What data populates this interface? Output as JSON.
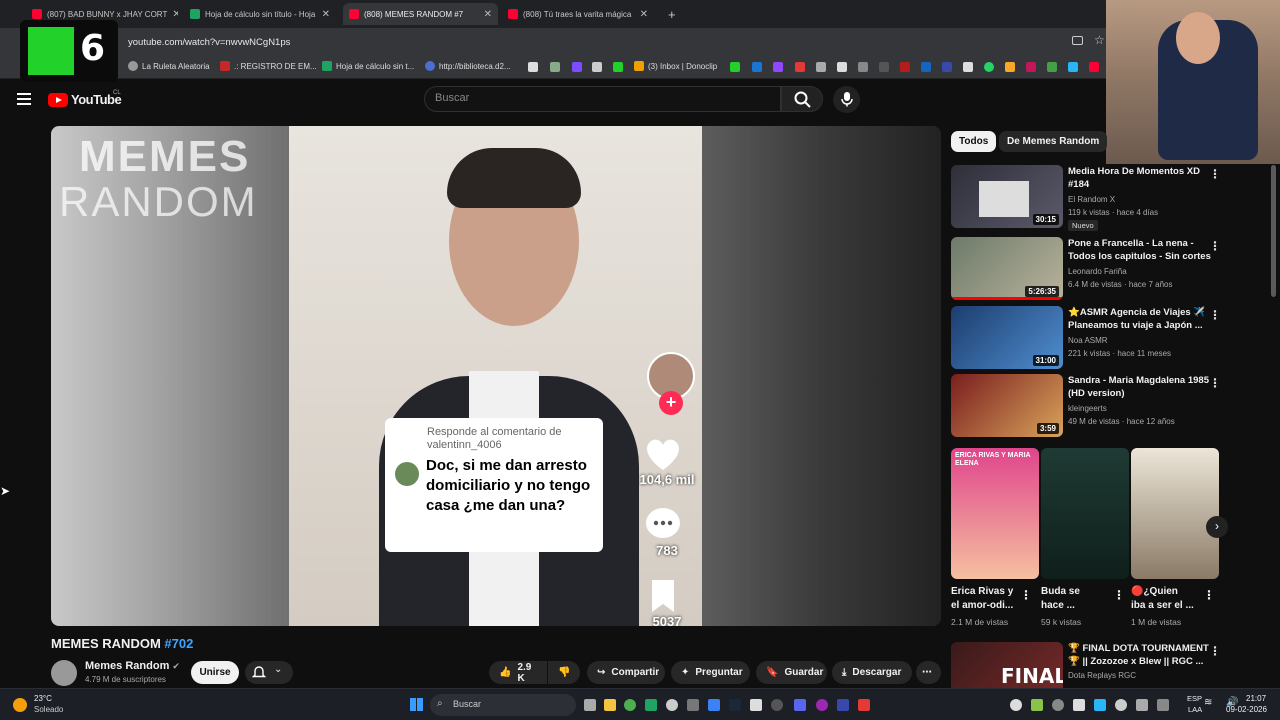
{
  "browser": {
    "tabs": [
      {
        "label": "(807) BAD BUNNY x JHAY CORT",
        "active": false
      },
      {
        "label": "Hoja de cálculo sin título - Hoja",
        "active": false
      },
      {
        "label": "(808) MEMES RANDOM #7",
        "active": true
      },
      {
        "label": "(808) Tú traes la varita mágica",
        "active": false
      }
    ],
    "new_tab": "+",
    "url": "youtube.com/watch?v=nwvwNCgN1ps",
    "bookmarks": [
      "La Ruleta Aleatoria",
      ".: REGISTRO DE EM...",
      "Hoja de cálculo sin t...",
      "http://biblioteca.d2...",
      "(3) Inbox | Donoclip"
    ]
  },
  "overlay": {
    "k6": "6"
  },
  "header": {
    "logo_text": "YouTube",
    "region": "CL",
    "search_placeholder": "Buscar"
  },
  "player": {
    "watermark_line1": "MEMES",
    "watermark_line2": "RANDOM",
    "comment_meta_1": "Responde al comentario de",
    "comment_meta_2": "valentinn_4006",
    "comment_text": "Doc, si me dan arresto domiciliario y no tengo casa ¿me dan una?",
    "likes": "104,6 mil",
    "comments": "783",
    "saves": "5037"
  },
  "video": {
    "title_main": "MEMES RANDOM ",
    "title_tag": "#702",
    "channel": "Memes Random",
    "subscribers": "4.79 M de suscriptores",
    "join_label": "Unirse",
    "like_count": "2.9 K",
    "share_label": "Compartir",
    "ask_label": "Preguntar",
    "save_label": "Guardar",
    "download_label": "Descargar"
  },
  "filters": [
    "Todos",
    "De Memes Random"
  ],
  "recommendations": [
    {
      "title": "Media Hora De Momentos XD #184",
      "channel": "El Random X",
      "meta": "119 k vistas · hace 4 días",
      "duration": "30:15",
      "badge": "Nuevo"
    },
    {
      "title": "Pone a Francella - La nena - Todos los capitulos - Sin cortes",
      "channel": "Leonardo Fariña",
      "meta": "6.4 M de vistas · hace 7 años",
      "duration": "5:26:35"
    },
    {
      "title": "⭐ASMR Agencia de Viajes ✈️ Planeamos tu viaje a Japón ...",
      "channel": "Noa ASMR",
      "meta": "221 k vistas · hace 11 meses",
      "duration": "31:00"
    },
    {
      "title": "Sandra - Maria Magdalena 1985 (HD version)",
      "channel": "kleingeerts",
      "meta": "49 M de vistas · hace 12 años",
      "duration": "3:59"
    }
  ],
  "shorts": [
    {
      "title": "Erica Rivas y el amor-odi...",
      "views": "2.1 M de vistas",
      "thumb_text": "ERICA RIVAS Y MARIA ELENA"
    },
    {
      "title": "Buda se hace ...",
      "views": "59 k vistas"
    },
    {
      "title": "🔴¿Quien iba a ser el ...",
      "views": "1 M de vistas"
    }
  ],
  "rec5": {
    "title": "🏆 FINAL DOTA TOURNAMENT 🏆 || Zozozoe x Blew || RGC ...",
    "channel": "Dota Replays RGC",
    "thumb_text": "FINAL"
  },
  "taskbar": {
    "temp": "23°C",
    "weather": "Soleado",
    "search": "Buscar",
    "lang1": "ESP",
    "lang2": "LAA",
    "time": "21:07",
    "date": "09-02-2026"
  }
}
